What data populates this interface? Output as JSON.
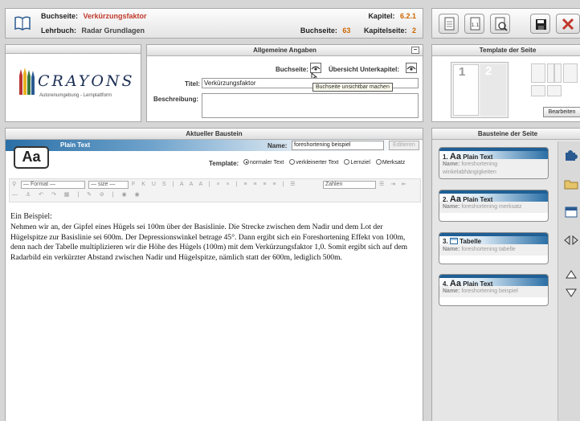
{
  "header": {
    "page_label": "Buchseite:",
    "page_name": "Verkürzungsfaktor",
    "book_label": "Lehrbuch:",
    "book_name": "Radar Grundlagen",
    "chapter_label": "Kapitel:",
    "chapter_value": "6.2.1",
    "bookpage_label": "Buchseite:",
    "bookpage_value": "63",
    "chapterpage_label": "Kapitelseite:",
    "chapterpage_value": "2"
  },
  "logo": {
    "brand": "CRAYONS",
    "tagline": "Autorenumgebung - Lernplattform"
  },
  "general": {
    "title": "Allgemeine Angaben",
    "buchseite_label": "Buchseite:",
    "overview_label": "Übersicht Unterkapitel:",
    "tooltip": "Buchseite unsichtbar machen",
    "titel_label": "Titel:",
    "titel_value": "Verkürzungsfaktor",
    "description_label": "Beschreibung:",
    "description_value": ""
  },
  "template_panel": {
    "title": "Template der Seite",
    "slot1": "1",
    "slot2": "2",
    "edit_button": "Bearbeiten"
  },
  "current_block": {
    "title": "Aktueller Baustein",
    "type_name": "Plain Text",
    "icon_text": "Aa",
    "name_label": "Name:",
    "name_value": "foreshortening beispiel",
    "edit_button": "Editieren",
    "template_label": "Template:",
    "template_options": [
      "normaler Text",
      "verkleinerter Text",
      "Lernziel",
      "Merksatz"
    ],
    "template_selected": "normaler Text",
    "format_select": "— Format —",
    "size_select": "— size —",
    "numbers_select": "Zahlen",
    "content_heading": "Ein Beispiel:",
    "content_body": "Nehmen wir an, der Gipfel eines Hügels sei 100m über der Basislinie. Die Strecke zwischen dem Nadir und dem Lot der Hügelspitze zur Basislinie sei 600m. Der Depressionswinkel betrage 45°. Dann ergibt sich ein Foreshortening Effekt von 100m, denn nach der Tabelle multiplizieren wir die Höhe des Hügels (100m) mit dem Verkürzungsfaktor 1,0. Somit ergibt sich auf dem Radarbild ein verkürzter Abstand zwischen Nadir und Hügelspitze, nämlich statt der 600m, lediglich 500m."
  },
  "blocks_panel": {
    "title": "Bausteine der Seite",
    "name_label": "Name:",
    "items": [
      {
        "num": "1.",
        "type": "Plain Text",
        "icon": "Aa",
        "name": "foreshortening winkelabhängigkeiten"
      },
      {
        "num": "2.",
        "type": "Plain Text",
        "icon": "Aa",
        "name": "foreshortening merksatz"
      },
      {
        "num": "3.",
        "type": "Tabelle",
        "icon": "table",
        "name": "foreshortening tabelle"
      },
      {
        "num": "4.",
        "type": "Plain Text",
        "icon": "Aa",
        "name": "foreshortening beispiel"
      }
    ]
  },
  "colors": {
    "accent_red": "#c0392b",
    "accent_orange": "#cc6600",
    "header_blue": "#2a6fa6"
  }
}
